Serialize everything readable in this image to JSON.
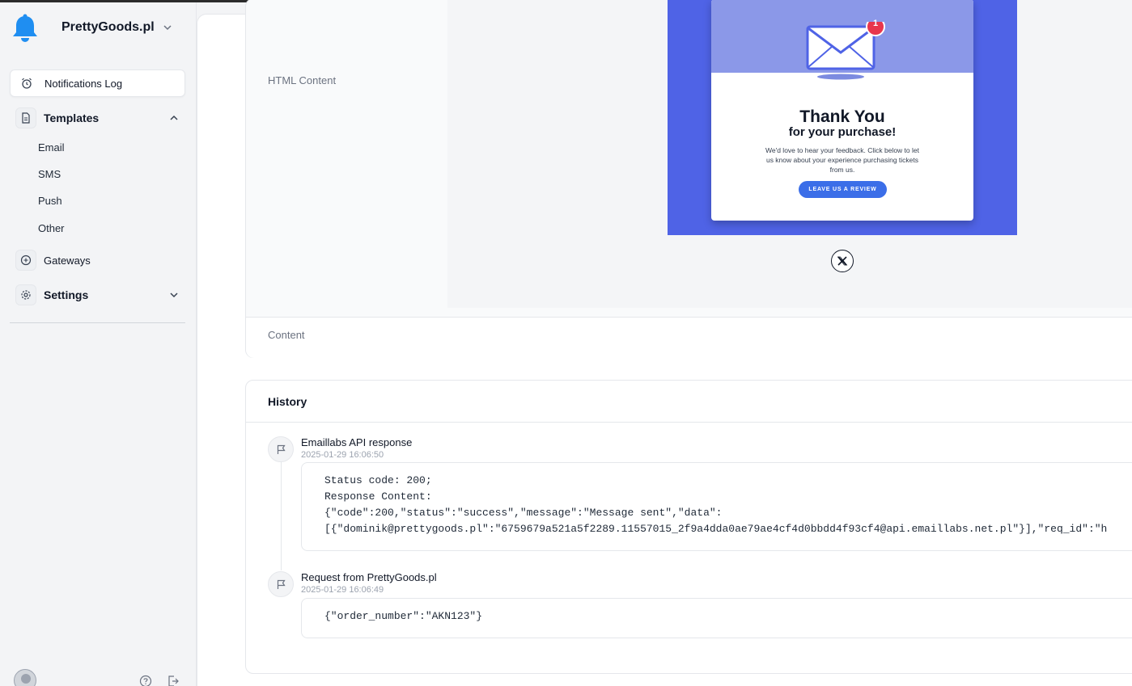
{
  "sidebar": {
    "brand": "PrettyGoods.pl",
    "nav": {
      "notifications_log": "Notifications Log",
      "templates": "Templates",
      "templates_children": [
        "Email",
        "SMS",
        "Push",
        "Other"
      ],
      "gateways": "Gateways",
      "settings": "Settings"
    }
  },
  "notification": {
    "html_content_label": "HTML Content",
    "content_label": "Content",
    "preview": {
      "badge": "1",
      "title": "Thank You",
      "subtitle": "for your purchase!",
      "body": "We'd love to hear your feedback. Click below to let us know about your experience purchasing tickets from us.",
      "button": "LEAVE US A REVIEW"
    }
  },
  "history": {
    "title": "History",
    "events": [
      {
        "title": "Emaillabs API response",
        "time": "2025-01-29 16:06:50",
        "body": "Status code: 200;\nResponse Content:\n{\"code\":200,\"status\":\"success\",\"message\":\"Message sent\",\"data\":\n[{\"dominik@prettygoods.pl\":\"6759679a521a5f2289.11557015_2f9a4dda0ae79ae4cf4d0bbdd4f93cf4@api.emaillabs.net.pl\"}],\"req_id\":\"h"
      },
      {
        "title": "Request from PrettyGoods.pl",
        "time": "2025-01-29 16:06:49",
        "body": "{\"order_number\":\"AKN123\"}"
      }
    ]
  },
  "colors": {
    "brand_bell": "#1f8ef1",
    "preview_bg": "#4f63e6",
    "preview_header": "#8b98e8",
    "badge": "#e8364d",
    "review_button": "#3b6ee8"
  },
  "icons": [
    "bell-icon",
    "chevron-down-icon",
    "alarm-icon",
    "document-icon",
    "chevron-up-icon",
    "gateway-icon",
    "gear-icon",
    "envelope-icon",
    "x-logo-icon",
    "flag-icon",
    "help-icon",
    "logout-icon"
  ]
}
